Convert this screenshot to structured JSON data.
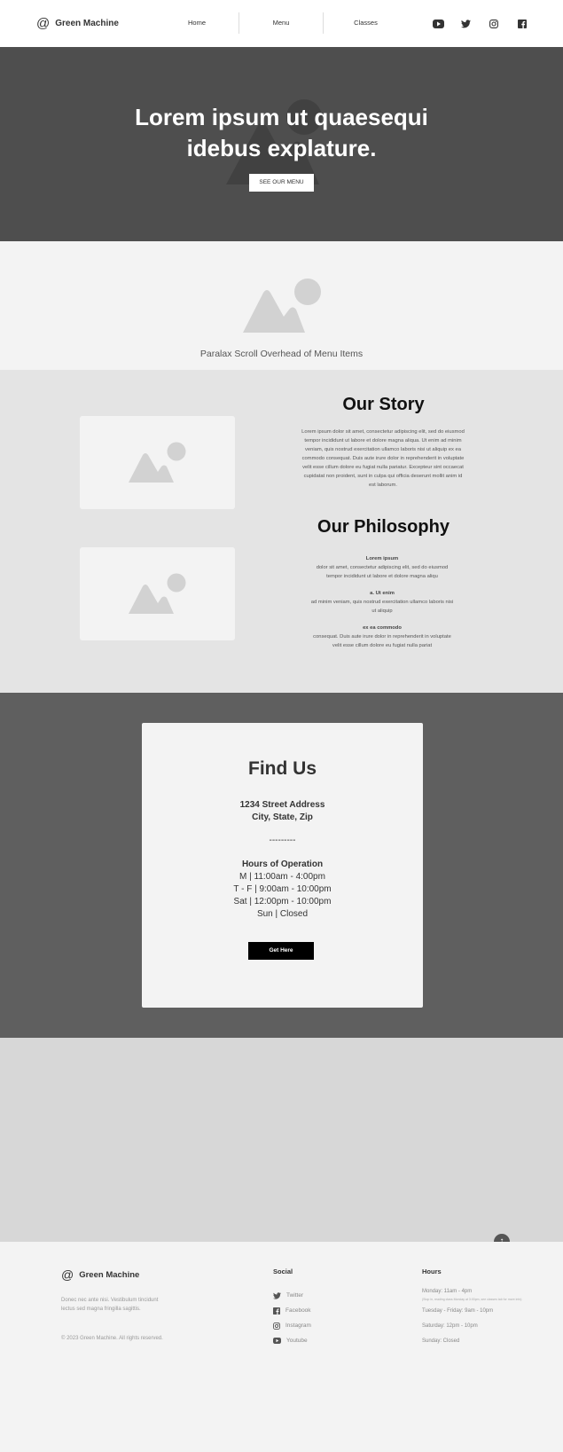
{
  "nav": {
    "brand": "Green Machine",
    "links": [
      "Home",
      "Menu",
      "Classes"
    ],
    "social_icons": [
      "youtube-icon",
      "twitter-icon",
      "instagram-icon",
      "facebook-icon"
    ]
  },
  "hero": {
    "title_line1": "Lorem ipsum ut quaesequi",
    "title_line2": "idebus explature.",
    "button": "SEE OUR MENU"
  },
  "parallax": {
    "caption": "Paralax Scroll Overhead of Menu Items"
  },
  "story": {
    "title": "Our Story",
    "text": "Lorem ipsum dolor sit amet, consectetur adipiscing elit, sed do eiusmod tempor incididunt ut labore et dolore magna aliqua. Ut enim ad minim veniam, quis nostrud exercitation ullamco laboris nisi ut aliquip ex ea commodo consequat. Duis aute irure dolor in reprehenderit in voluptate velit esse cillum dolore eu fugiat nulla pariatur. Excepteur sint occaecat cupidatat non proident, sunt in culpa qui officia deserunt mollit anim id est laborum."
  },
  "philosophy": {
    "title": "Our Philosophy",
    "items": [
      {
        "heading": "Lorem ipsum",
        "text": "dolor sit amet, consectetur adipiscing elit, sed do eiusmod tempor incididunt ut labore et dolore magna aliqu"
      },
      {
        "heading": "a. Ut enim",
        "text": "ad minim veniam, quis nostrud exercitation ullamco laboris nisi ut aliquip"
      },
      {
        "heading": "ex ea commodo",
        "text": "consequat. Duis aute irure dolor in reprehenderit in voluptate velit esse cillum dolore eu fugiat nulla pariat"
      }
    ]
  },
  "findus": {
    "title": "Find Us",
    "address_line1": "1234 Street Address",
    "address_line2": "City, State, Zip",
    "divider": "---------",
    "hours_heading": "Hours of Operation",
    "hours": [
      "M  |  11:00am - 4:00pm",
      "T - F  |  9:00am - 10:00pm",
      "Sat  |  12:00pm - 10:00pm",
      "Sun  |  Closed"
    ],
    "button": "Get Here"
  },
  "footer": {
    "brand": "Green Machine",
    "description": "Donec nec ante nisi. Vestibulum tincidunt lectus sed magna fringilla sagittis.",
    "copyright": "© 2023 Green Machine.  All rights reserved.",
    "social_heading": "Social",
    "social": [
      "Twitter",
      "Facebook",
      "Instagram",
      "Youtube"
    ],
    "hours_heading": "Hours",
    "hours": [
      "Monday:  11am - 4pm",
      "Tuesday - Friday: 9am - 10pm",
      "Saturday: 12pm - 10pm",
      "Sunday: Closed"
    ],
    "hours_note": "(Stop in, reading class Monday at 3:00pm, see classes tab for more info)"
  }
}
